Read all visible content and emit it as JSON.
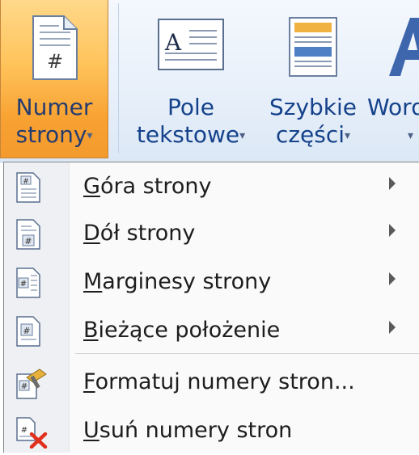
{
  "ribbon": {
    "buttons": [
      {
        "label_line1": "Numer",
        "label_line2": "strony",
        "icon": "page-number-icon",
        "state": "pressed"
      },
      {
        "label_line1": "Pole",
        "label_line2": "tekstowe",
        "icon": "textbox-icon"
      },
      {
        "label_line1": "Szybkie",
        "label_line2": "części",
        "icon": "quick-parts-icon"
      },
      {
        "label_line1": "Word",
        "label_line2": "",
        "icon": "wordart-icon"
      }
    ],
    "dropdown_arrow": "▾"
  },
  "menu": {
    "items": [
      {
        "accel": "G",
        "rest": "óra strony",
        "icon": "page-top-number-icon",
        "submenu": true
      },
      {
        "accel": "D",
        "rest": "ół strony",
        "icon": "page-bottom-number-icon",
        "submenu": true
      },
      {
        "accel": "M",
        "rest": "arginesy strony",
        "icon": "page-margin-number-icon",
        "submenu": true
      },
      {
        "accel": "B",
        "rest": "ieżące położenie",
        "icon": "current-position-number-icon",
        "submenu": true
      },
      {
        "accel": "F",
        "rest": "ormatuj numery stron...",
        "icon": "format-page-numbers-icon",
        "submenu": false
      },
      {
        "accel": "U",
        "rest": "suń numery stron",
        "icon": "remove-page-numbers-icon",
        "submenu": false
      }
    ]
  },
  "colors": {
    "accent_pressed": "#f8a232",
    "ribbon_text": "#15428b",
    "remove_x": "#e0301e"
  }
}
